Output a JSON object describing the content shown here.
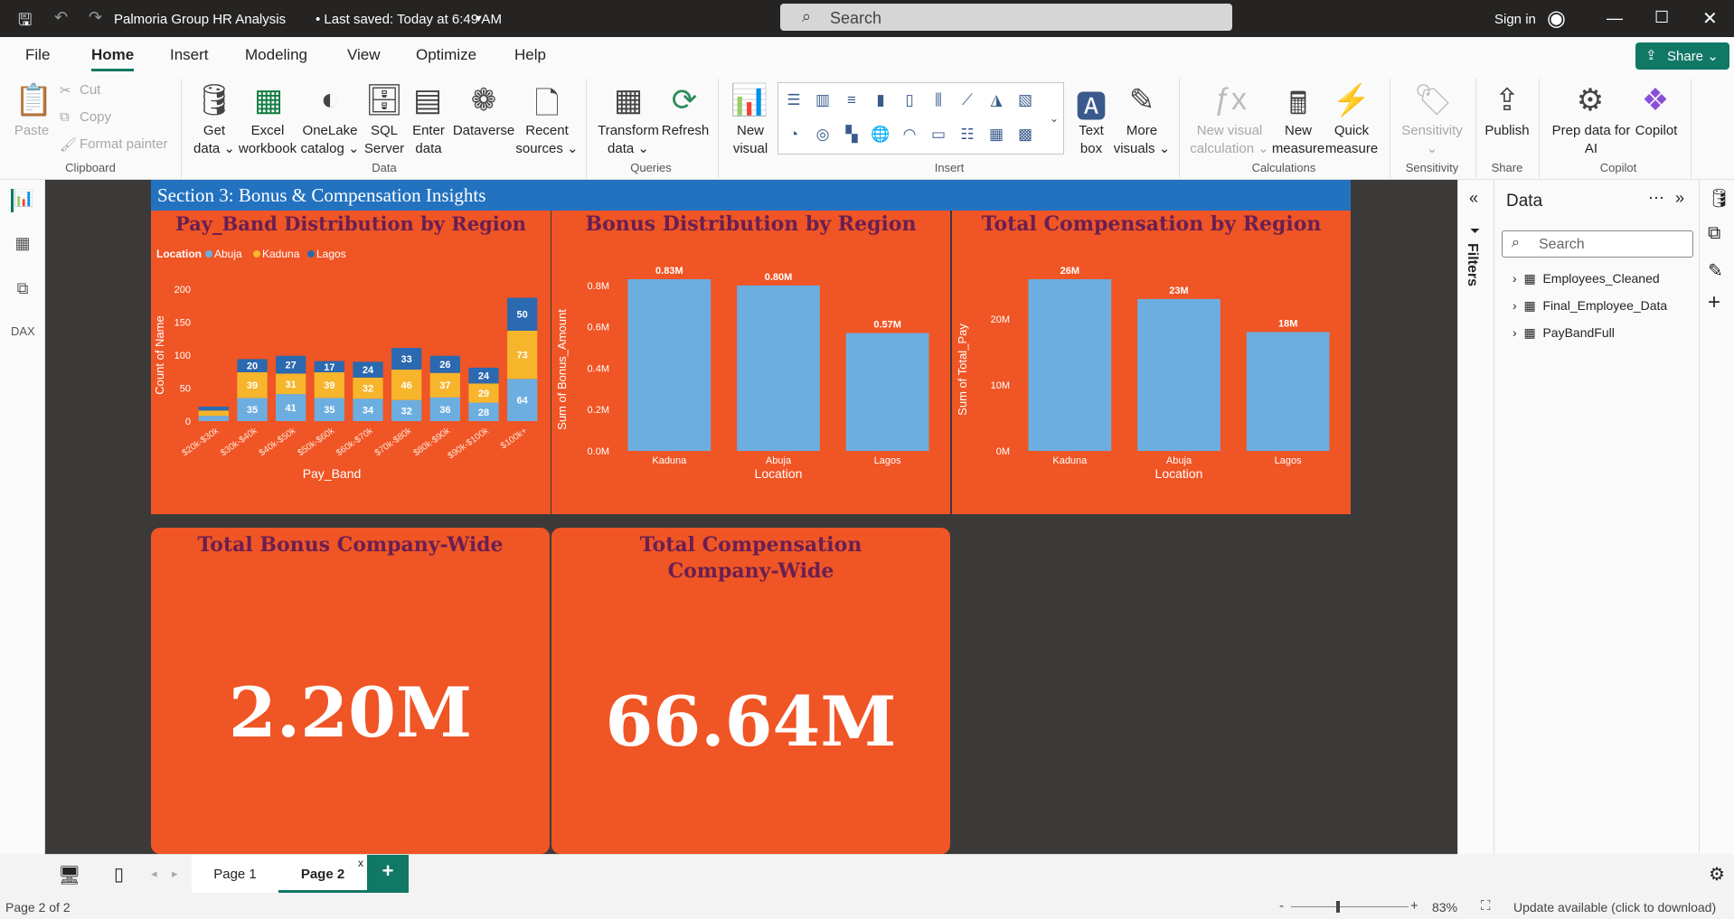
{
  "window": {
    "title": "Palmoria Group HR Analysis",
    "saved": "• Last saved: Today at 6:49 AM",
    "search_placeholder": "Search",
    "sign_in": "Sign in"
  },
  "menu": [
    "File",
    "Home",
    "Insert",
    "Modeling",
    "View",
    "Optimize",
    "Help"
  ],
  "share": "Share",
  "ribbon": {
    "clipboard": {
      "paste": "Paste",
      "cut": "Cut",
      "copy": "Copy",
      "format_painter": "Format painter",
      "group": "Clipboard"
    },
    "data": {
      "get_data": [
        "Get",
        "data ⌄"
      ],
      "excel": [
        "Excel",
        "workbook"
      ],
      "onelake": [
        "OneLake",
        "catalog ⌄"
      ],
      "sql": [
        "SQL",
        "Server"
      ],
      "enter": [
        "Enter",
        "data"
      ],
      "dataverse": [
        "Dataverse",
        ""
      ],
      "recent": [
        "Recent",
        "sources ⌄"
      ],
      "group": "Data"
    },
    "queries": {
      "transform": [
        "Transform",
        "data ⌄"
      ],
      "refresh": [
        "Refresh",
        ""
      ],
      "group": "Queries"
    },
    "insert": {
      "new_visual": [
        "New",
        "visual"
      ],
      "text_box": [
        "Text",
        "box"
      ],
      "more_visuals": [
        "More",
        "visuals ⌄"
      ],
      "group": "Insert"
    },
    "calculations": {
      "new_visual_calc": [
        "New visual",
        "calculation ⌄"
      ],
      "new_measure": [
        "New",
        "measure"
      ],
      "quick_measure": [
        "Quick",
        "measure"
      ],
      "group": "Calculations"
    },
    "sensitivity": {
      "label": [
        "Sensitivity",
        "⌄"
      ],
      "group": "Sensitivity"
    },
    "share": {
      "publish": "Publish",
      "group": "Share"
    },
    "copilot": {
      "prep": [
        "Prep data for",
        "AI"
      ],
      "copilot": "Copilot",
      "group": "Copilot"
    }
  },
  "report": {
    "banner": "Section 3: Bonus & Compensation Insights",
    "chart1_title": "Pay_Band Distribution by Region",
    "chart2_title": "Bonus Distribution by Region",
    "chart3_title": "Total Compensation by Region",
    "kpi1_title": "Total Bonus Company-Wide",
    "kpi1_value": "2.20M",
    "kpi2_title_a": "Total Compensation",
    "kpi2_title_b": "Company-Wide",
    "kpi2_value": "66.64M"
  },
  "chart_data": [
    {
      "type": "bar",
      "stacked": true,
      "title": "Pay_Band Distribution by Region",
      "legend_title": "Location",
      "legend_position": "top-left",
      "categories": [
        "$20k-$30k",
        "$30k-$40k",
        "$40k-$50k",
        "$50k-$60k",
        "$60k-$70k",
        "$70k-$80k",
        "$80k-$90k",
        "$90k-$100k",
        "$100k+"
      ],
      "series": [
        {
          "name": "Abuja",
          "color": "#6caee0",
          "values": [
            8,
            35,
            41,
            35,
            34,
            32,
            36,
            28,
            64
          ],
          "labels": [
            "",
            "35",
            "41",
            "35",
            "34",
            "32",
            "36",
            "28",
            "64"
          ]
        },
        {
          "name": "Kaduna",
          "color": "#f7b52c",
          "values": [
            8,
            39,
            31,
            39,
            32,
            46,
            37,
            29,
            73
          ],
          "labels": [
            "",
            "39",
            "31",
            "39",
            "32",
            "46",
            "37",
            "29",
            "73"
          ]
        },
        {
          "name": "Lagos",
          "color": "#2b69b0",
          "values": [
            6,
            20,
            27,
            17,
            24,
            33,
            26,
            24,
            50
          ],
          "labels": [
            "",
            "20",
            "27",
            "17",
            "24",
            "33",
            "26",
            "24",
            "50"
          ]
        }
      ],
      "xlabel": "Pay_Band",
      "ylabel": "Count of Name",
      "ylim": [
        0,
        200
      ],
      "yticks": [
        "0",
        "50",
        "100",
        "150",
        "200"
      ]
    },
    {
      "type": "bar",
      "title": "Bonus Distribution by Region",
      "categories": [
        "Kaduna",
        "Abuja",
        "Lagos"
      ],
      "values": [
        0.83,
        0.8,
        0.57
      ],
      "labels": [
        "0.83M",
        "0.80M",
        "0.57M"
      ],
      "xlabel": "Location",
      "ylabel": "Sum of Bonus_Amount",
      "ylim": [
        0,
        0.8
      ],
      "yticks": [
        "0.0M",
        "0.2M",
        "0.4M",
        "0.6M",
        "0.8M"
      ],
      "color": "#6caee0"
    },
    {
      "type": "bar",
      "title": "Total Compensation by Region",
      "categories": [
        "Kaduna",
        "Abuja",
        "Lagos"
      ],
      "values": [
        26,
        23,
        18
      ],
      "labels": [
        "26M",
        "23M",
        "18M"
      ],
      "xlabel": "Location",
      "ylabel": "Sum of Total_Pay",
      "ylim": [
        0,
        20
      ],
      "yticks": [
        "0M",
        "10M",
        "20M"
      ],
      "color": "#6caee0"
    }
  ],
  "filters_label": "Filters",
  "data_pane": {
    "title": "Data",
    "search_placeholder": "Search",
    "tables": [
      "Employees_Cleaned",
      "Final_Employee_Data",
      "PayBandFull"
    ]
  },
  "pages": {
    "tabs": [
      "Page 1",
      "Page 2"
    ],
    "add": "+",
    "close": "x"
  },
  "status": {
    "page": "Page 2 of 2",
    "zoom": "83%",
    "update": "Update available (click to download)",
    "minus": "-",
    "plus": "+"
  }
}
